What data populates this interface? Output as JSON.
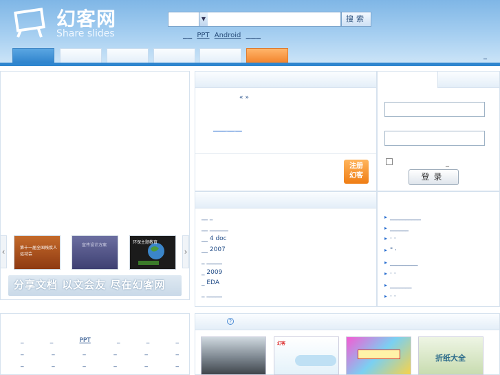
{
  "header": {
    "logo_cn": "幻客网",
    "logo_en": "Share slides",
    "search": {
      "category_value": "",
      "input_value": "",
      "button_label": "搜索"
    },
    "hot_links": [
      "_ _",
      "PPT",
      "Android",
      "_ _ _"
    ],
    "tabs": [
      "",
      "",
      "",
      "",
      "",
      ""
    ],
    "right_link": "_"
  },
  "slider": {
    "caption": "分享文档 以文会友 尽在幻客网",
    "prev_icon": "‹",
    "next_icon": "›",
    "thumbs": [
      {
        "title": "第十一届全国残疾人运动会",
        "color": "#b85a1c"
      },
      {
        "title": "宣传设计方案",
        "color": "#5a5c8e"
      },
      {
        "title": "环保主题教育",
        "color": "#1a1a1a"
      }
    ]
  },
  "mid_links": {
    "line1": "«    »",
    "line2": "____   __  __"
  },
  "register_button": "注册\n幻客",
  "login": {
    "username_value": "",
    "password_value": "",
    "remember_label": "_",
    "button_label": "登录"
  },
  "list_mid": [
    "__   _",
    "__   ______",
    "__   4   doc",
    "__   2007",
    "_   _____",
    "_   2009",
    "_   EDA",
    "_   _____"
  ],
  "list_right": [
    "__________",
    "______",
    "·  ·",
    "\"  ·",
    "_________",
    "·    ·",
    "_______",
    "· ·"
  ],
  "bottom_left": {
    "row1": [
      "_",
      "_",
      "PPT",
      "_",
      "_",
      "_"
    ],
    "row2": [
      "_",
      "_",
      "_",
      "_",
      "_",
      "_"
    ],
    "row3": [
      "_",
      "_",
      "_",
      "_",
      "_",
      "_"
    ]
  },
  "bottom_right": {
    "help_icon": "?",
    "thumbs": [
      {
        "caption": "",
        "color": "#5e6a74"
      },
      {
        "caption": "",
        "color": "#e8f4fb"
      },
      {
        "caption": "",
        "color": "#c85ab8"
      },
      {
        "caption": "折纸大全",
        "color": "#cfe0b8"
      }
    ]
  }
}
